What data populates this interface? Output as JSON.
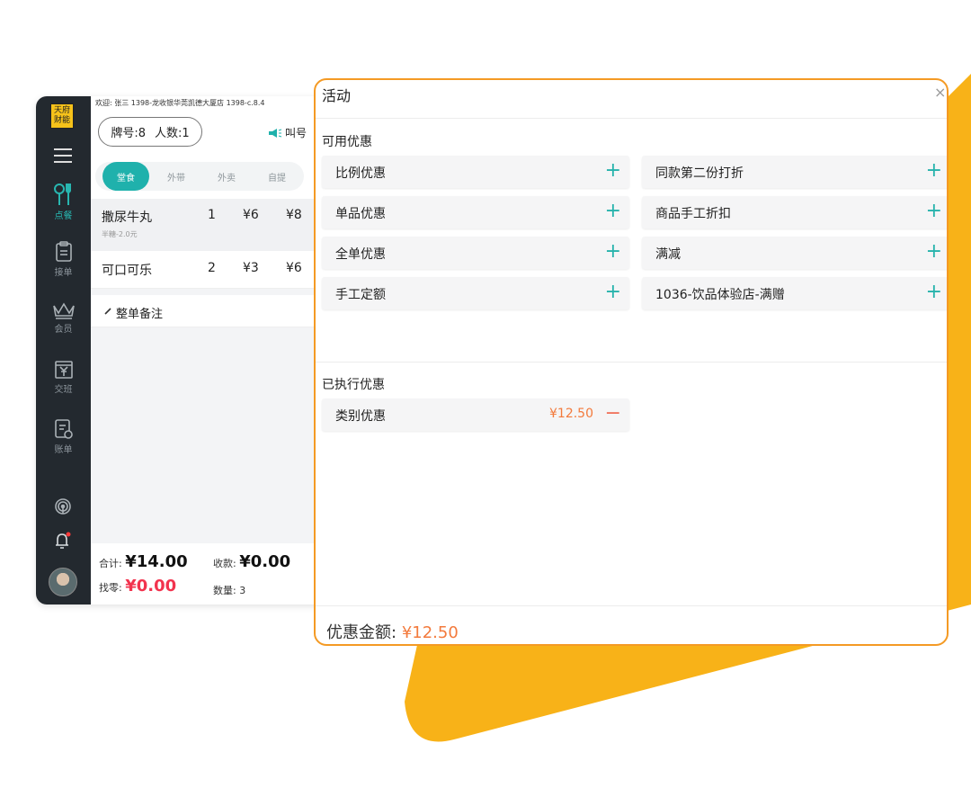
{
  "colors": {
    "accent": "#1fb1ac",
    "brand_orange": "#f49a24",
    "background_shape": "#f8b218",
    "discount_text": "#f37a3c",
    "red_value": "#f2334e",
    "sidebar_bg": "#23292f"
  },
  "pos": {
    "logo_line1": "天府",
    "logo_line2": "财能",
    "top_info": "欢迎: 张三    1398-龙收银华莞凯德大厦店    1398-c.8.4",
    "tag_number": "牌号:8",
    "people_count": "人数:1",
    "call_label": "叫号",
    "tabs": [
      {
        "label": "堂食",
        "active": true
      },
      {
        "label": "外带",
        "active": false
      },
      {
        "label": "外卖",
        "active": false
      },
      {
        "label": "自提",
        "active": false
      }
    ],
    "nav": [
      {
        "label": "点餐",
        "icon": "fork-knife-icon",
        "active": true
      },
      {
        "label": "接单",
        "icon": "clipboard-icon",
        "active": false
      },
      {
        "label": "会员",
        "icon": "crown-icon",
        "active": false
      },
      {
        "label": "交班",
        "icon": "yen-box-icon",
        "active": false
      },
      {
        "label": "账单",
        "icon": "bill-icon",
        "active": false
      }
    ],
    "order_items": [
      {
        "name": "撒尿牛丸",
        "qty": "1",
        "price": "¥6",
        "total": "¥8",
        "sub": "半糖-2.0元"
      },
      {
        "name": "可口可乐",
        "qty": "2",
        "price": "¥3",
        "total": "¥6",
        "sub": ""
      }
    ],
    "note_label": "整单备注",
    "total_label": "合计:",
    "total_value": "¥14.00",
    "received_label": "收款:",
    "received_value": "¥0.00",
    "change_label": "找零:",
    "change_value": "¥0.00",
    "count_label": "数量:",
    "count_value": "3"
  },
  "dialog": {
    "title": "活动",
    "close": "×",
    "available_section": "可用优惠",
    "available_left": [
      "比例优惠",
      "单品优惠",
      "全单优惠",
      "手工定额"
    ],
    "available_right": [
      "同款第二份打折",
      "商品手工折扣",
      "满减",
      "1036-饮品体验店-满赠"
    ],
    "executed_section": "已执行优惠",
    "executed": [
      {
        "label": "类别优惠",
        "amount": "¥12.50"
      }
    ],
    "footer_label": "优惠金额:",
    "footer_value": "¥12.50"
  }
}
